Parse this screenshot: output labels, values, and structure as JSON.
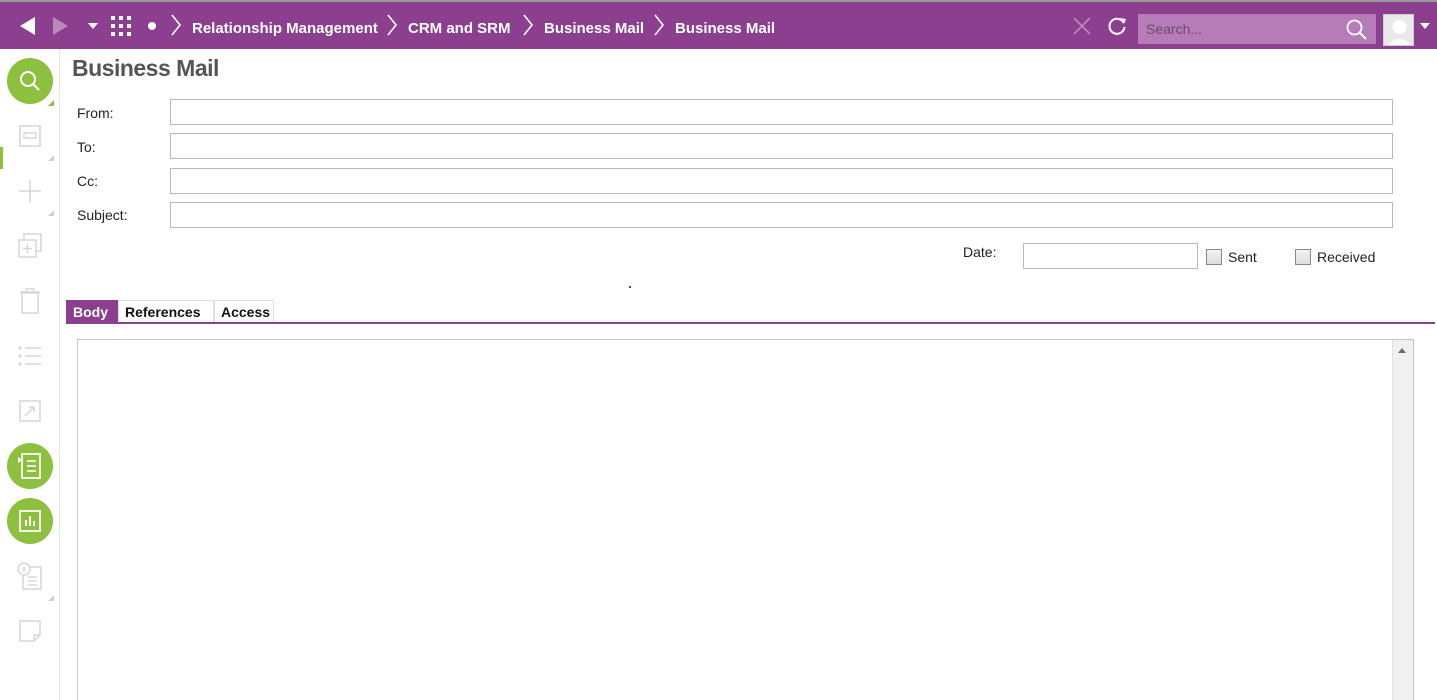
{
  "topbar": {
    "breadcrumbs": [
      "Relationship Management",
      "CRM and SRM",
      "Business Mail",
      "Business Mail"
    ],
    "search_placeholder": "Search...",
    "color": "#8c3f8f"
  },
  "sidebar": {
    "items": [
      {
        "icon": "search-icon",
        "active": true
      },
      {
        "icon": "save-icon",
        "active": false
      },
      {
        "icon": "plus-icon",
        "active": false
      },
      {
        "icon": "duplicate-icon",
        "active": false
      },
      {
        "icon": "trash-icon",
        "active": false
      },
      {
        "icon": "list-icon",
        "active": false
      },
      {
        "icon": "open-external-icon",
        "active": false
      },
      {
        "icon": "document-list-icon",
        "active": true
      },
      {
        "icon": "report-chart-icon",
        "active": true
      },
      {
        "icon": "info-document-icon",
        "active": false
      },
      {
        "icon": "note-icon",
        "active": false
      }
    ],
    "accent": "#8dc03f"
  },
  "form": {
    "title": "Business Mail",
    "from_label": "From:",
    "to_label": "To:",
    "cc_label": "Cc:",
    "subject_label": "Subject:",
    "date_label": "Date:",
    "sent_label": "Sent",
    "received_label": "Received",
    "from_value": "",
    "to_value": "",
    "cc_value": "",
    "subject_value": "",
    "date_value": "",
    "sent_checked": false,
    "received_checked": false
  },
  "tabs": [
    {
      "label": "Body",
      "active": true
    },
    {
      "label": "References",
      "active": false
    },
    {
      "label": "Access",
      "active": false
    }
  ]
}
